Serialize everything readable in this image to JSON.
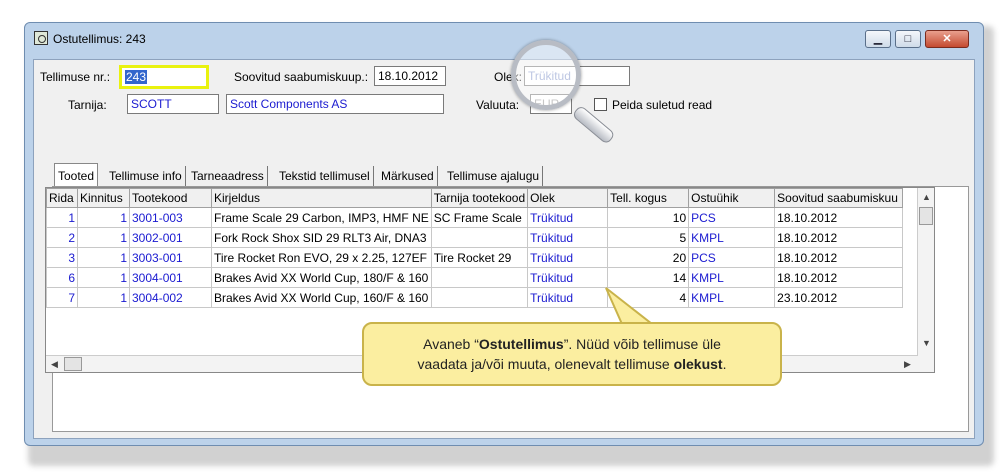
{
  "window": {
    "title": "Ostutellimus: 243",
    "minimize_glyph": "▁",
    "maximize_glyph": "□",
    "close_glyph": "✕"
  },
  "form": {
    "order_nr_label": "Tellimuse nr.:",
    "order_nr_value": "243",
    "arrival_label": "Soovitud saabumiskuup.:",
    "arrival_value": "18.10.2012",
    "status_label": "Olek:",
    "status_value": "Trükitud",
    "supplier_label": "Tarnija:",
    "supplier_code": "SCOTT",
    "supplier_name": "Scott Components AS",
    "currency_label": "Valuuta:",
    "currency_value": "EUR",
    "hide_closed_label": "Peida suletud read"
  },
  "tabs": [
    {
      "label": "Tooted"
    },
    {
      "label": "Tellimuse info"
    },
    {
      "label": "Tarneaadress"
    },
    {
      "label": "Tekstid tellimusel"
    },
    {
      "label": "Märkused"
    },
    {
      "label": "Tellimuse ajalugu"
    }
  ],
  "grid": {
    "columns": [
      "Rida",
      "Kinnitus",
      "Tootekood",
      "Kirjeldus",
      "Tarnija tootekood",
      "Olek",
      "Tell. kogus",
      "Ostuühik",
      "Soovitud saabumiskuu"
    ],
    "rows": [
      {
        "rida": "1",
        "kinnitus": "1",
        "kood": "3001-003",
        "kirjeldus": "Frame Scale 29 Carbon, IMP3, HMF NE",
        "tarnija_kood": "SC Frame Scale",
        "olek": "Trükitud",
        "kogus": "10",
        "uhik": "PCS",
        "kuup": "18.10.2012"
      },
      {
        "rida": "2",
        "kinnitus": "1",
        "kood": "3002-001",
        "kirjeldus": "Fork Rock Shox SID 29 RLT3 Air, DNA3",
        "tarnija_kood": "",
        "olek": "Trükitud",
        "kogus": "5",
        "uhik": "KMPL",
        "kuup": "18.10.2012"
      },
      {
        "rida": "3",
        "kinnitus": "1",
        "kood": "3003-001",
        "kirjeldus": "Tire Rocket Ron EVO, 29 x 2.25, 127EF",
        "tarnija_kood": "Tire Rocket 29",
        "olek": "Trükitud",
        "kogus": "20",
        "uhik": "PCS",
        "kuup": "18.10.2012"
      },
      {
        "rida": "6",
        "kinnitus": "1",
        "kood": "3004-001",
        "kirjeldus": "Brakes Avid XX World Cup, 180/F & 160",
        "tarnija_kood": "",
        "olek": "Trükitud",
        "kogus": "14",
        "uhik": "KMPL",
        "kuup": "18.10.2012"
      },
      {
        "rida": "7",
        "kinnitus": "1",
        "kood": "3004-002",
        "kirjeldus": "Brakes Avid XX World Cup, 160/F & 160",
        "tarnija_kood": "",
        "olek": "Trükitud",
        "kogus": "4",
        "uhik": "KMPL",
        "kuup": "23.10.2012"
      }
    ]
  },
  "callout": {
    "text_1": "Avaneb “",
    "bold_1": "Ostutellimus",
    "text_2": "”. Nüüd võib tellimuse üle",
    "text_3": "vaadata ja/või muuta, olenevalt tellimuse ",
    "bold_2": "olekust",
    "text_4": "."
  },
  "colors": {
    "highlight_box": "#e9f20e",
    "link_blue": "#1a1ad0",
    "callout_bg": "#fbeea0"
  }
}
